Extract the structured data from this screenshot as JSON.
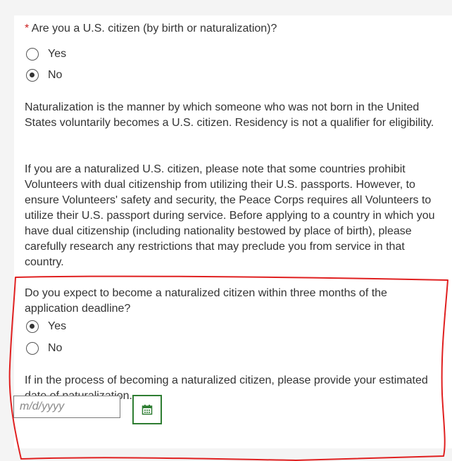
{
  "citizen_question": {
    "required_marker": "*",
    "text": "Are you a U.S. citizen (by birth or naturalization)?",
    "options": [
      {
        "label": "Yes",
        "checked": false
      },
      {
        "label": "No",
        "checked": true
      }
    ]
  },
  "info": {
    "naturalization_note": "Naturalization is the manner by which someone who was not born in the United States voluntarily becomes a U.S. citizen. Residency is not a qualifier for eligibility.",
    "dual_citizenship_note": "If you are a naturalized U.S. citizen, please note that some countries prohibit Volunteers with dual citizenship from utilizing their U.S. passports. However, to ensure Volunteers' safety and security, the Peace Corps requires all Volunteers to utilize their U.S. passport during service. Before applying to a country in which you have dual citizenship (including nationality bestowed by place of birth), please carefully research any restrictions that may preclude you from service in that country."
  },
  "naturalize_question": {
    "text": "Do you expect to become a naturalized citizen within three months of the application deadline?",
    "options": [
      {
        "label": "Yes",
        "checked": true
      },
      {
        "label": "No",
        "checked": false
      }
    ]
  },
  "date_section": {
    "prompt": "If in the process of becoming a naturalized citizen, please provide your estimated date of naturalization.",
    "value": "",
    "placeholder": "m/d/yyyy",
    "calendar_icon": "calendar-icon"
  },
  "colors": {
    "calendar_accent": "#2e7d32",
    "annotation": "#e02020",
    "required": "#cc2222"
  }
}
